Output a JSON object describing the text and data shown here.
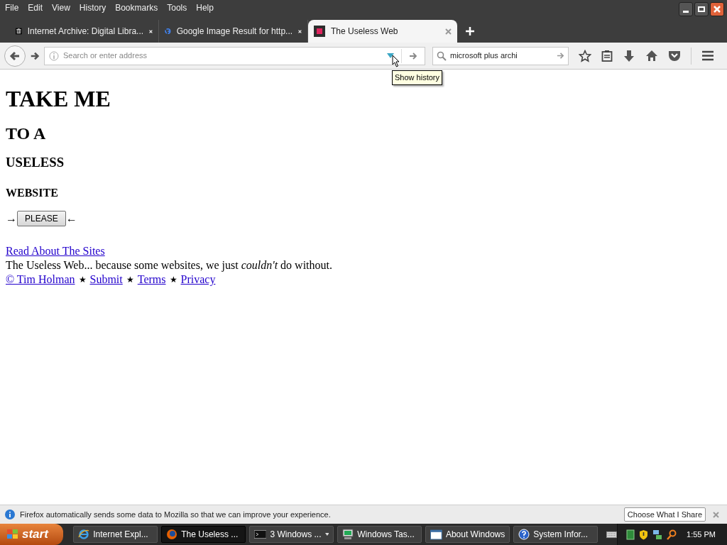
{
  "menu": [
    "File",
    "Edit",
    "View",
    "History",
    "Bookmarks",
    "Tools",
    "Help"
  ],
  "tabs": [
    {
      "title": "Internet Archive: Digital Libra...",
      "kind": "archive",
      "selected": false
    },
    {
      "title": "Google Image Result for http...",
      "kind": "google",
      "selected": false
    },
    {
      "title": "The Useless Web",
      "kind": "square",
      "selected": true
    }
  ],
  "address_bar": {
    "placeholder": "Search or enter address",
    "tooltip": "Show history"
  },
  "search": {
    "value": "microsoft plus archi"
  },
  "page": {
    "headings": [
      {
        "text": "TAKE ME",
        "kind": "h1"
      },
      {
        "text": "TO A",
        "kind": "h2"
      },
      {
        "text": "USELESS",
        "kind": "h3"
      },
      {
        "text": "WEBSITE",
        "kind": "h4"
      }
    ],
    "arrow_left": "→",
    "button": "PLEASE",
    "arrow_right": "←",
    "link": "Read About The Sites",
    "tagline": "The Useless Web... because some websites, we just *couldn't* do without.",
    "footer": [
      {
        "kind": "link",
        "text": "© Tim Holman"
      },
      {
        "kind": "separator",
        "text": "★"
      },
      {
        "kind": "link",
        "text": "Submit"
      },
      {
        "kind": "separator",
        "text": "★"
      },
      {
        "kind": "link",
        "text": "Terms"
      },
      {
        "kind": "separator",
        "text": "★"
      },
      {
        "kind": "link",
        "text": "Privacy"
      }
    ]
  },
  "notification": {
    "text": "Firefox automatically sends some data to Mozilla so that we can improve your experience.",
    "button": "Choose What I Share"
  },
  "taskbar": {
    "start": "start",
    "items": [
      {
        "label": "Internet Expl...",
        "kind": "ie",
        "selected": false
      },
      {
        "label": "The Useless ...",
        "kind": "firefox",
        "selected": true
      },
      {
        "label": "3 Windows ...",
        "kind": "console",
        "selected": false
      },
      {
        "label": "Windows Tas...",
        "kind": "monitor",
        "selected": false
      },
      {
        "label": "About Windows",
        "kind": "window",
        "selected": false
      },
      {
        "label": "System Infor...",
        "kind": "help",
        "selected": false
      }
    ],
    "time": "1:55 PM"
  }
}
